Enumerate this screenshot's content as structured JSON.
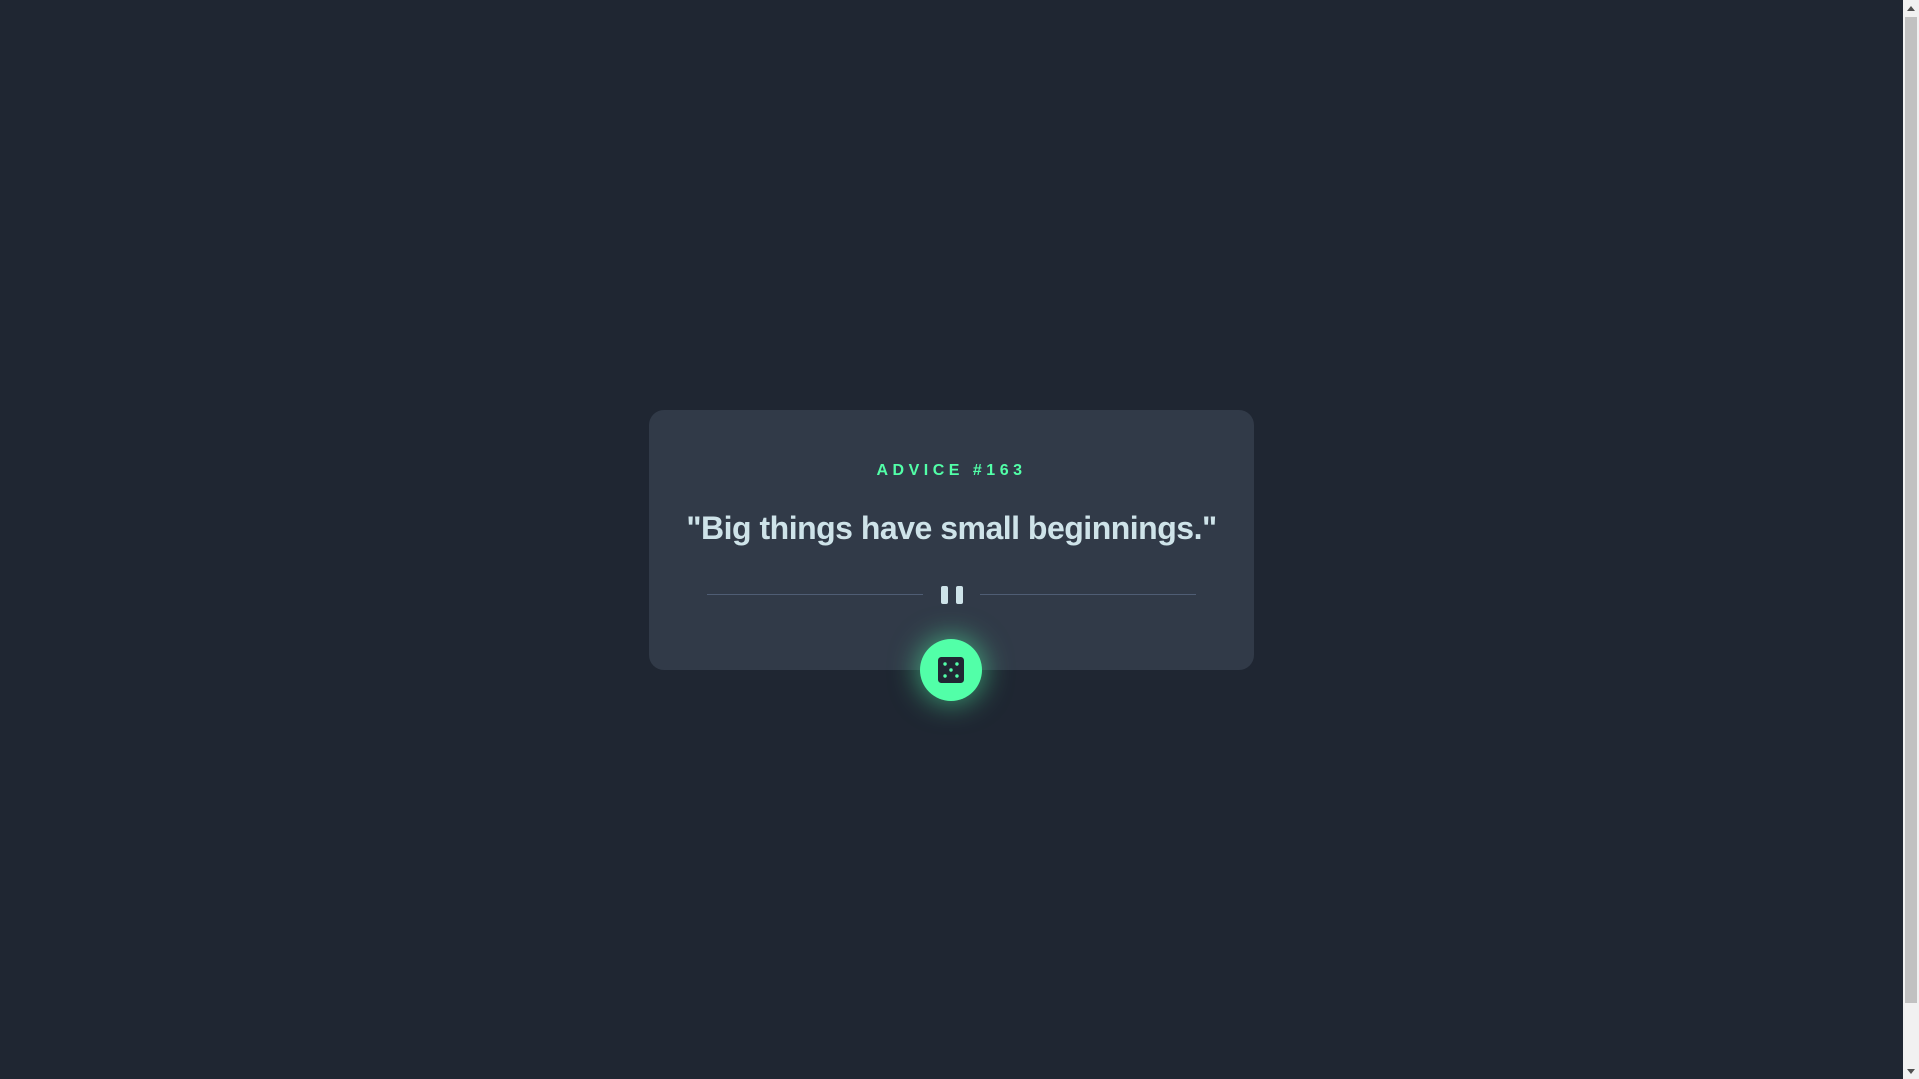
{
  "advice": {
    "id_label": "ADVICE #163",
    "text": "\"Big things have small beginnings.\""
  },
  "icons": {
    "divider": "pause-icon",
    "button": "dice-icon"
  },
  "colors": {
    "background": "#1f2632",
    "card": "#313a48",
    "accent": "#52ffa8",
    "text": "#cee3e9"
  }
}
